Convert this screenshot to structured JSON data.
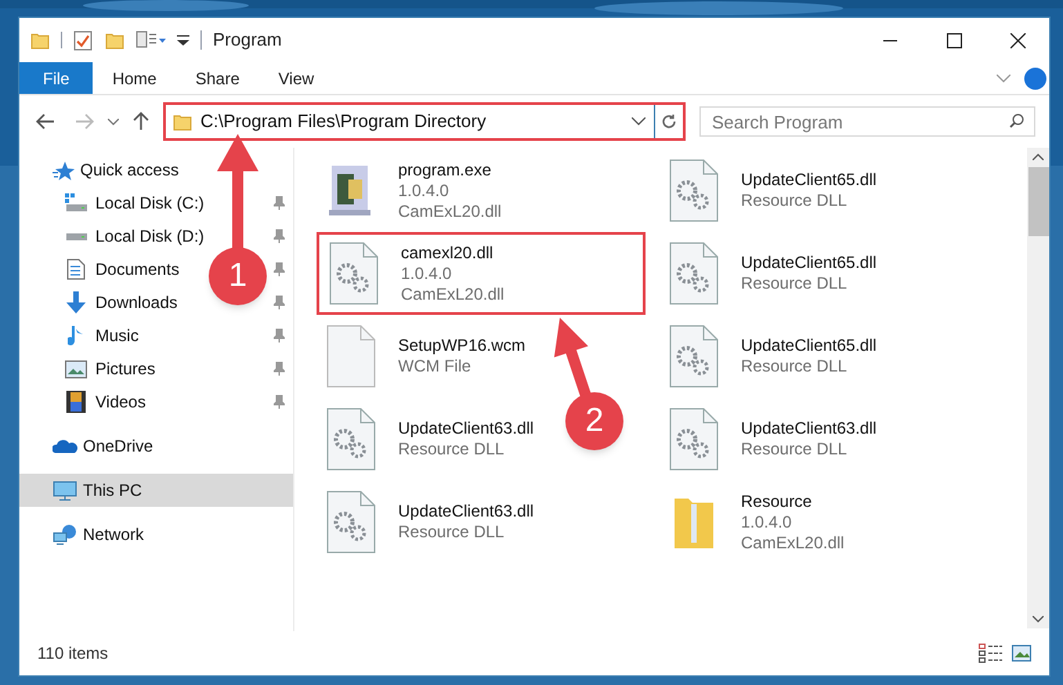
{
  "window": {
    "title": "Program"
  },
  "ribbon_tabs": [
    {
      "label": "File",
      "selected": true
    },
    {
      "label": "Home",
      "selected": false
    },
    {
      "label": "Share",
      "selected": false
    },
    {
      "label": "View",
      "selected": false
    }
  ],
  "address_bar": {
    "path": "C:\\Program Files\\Program Directory",
    "highlighted": true
  },
  "search": {
    "placeholder": "Search Program"
  },
  "navigation": [
    {
      "label": "Quick access",
      "selected": false,
      "children": [
        {
          "label": "Local Disk (C:)",
          "pinned": true,
          "selected": false
        },
        {
          "label": "Local Disk (D:)",
          "pinned": true,
          "selected": false
        },
        {
          "label": "Documents",
          "pinned": true,
          "selected": false
        },
        {
          "label": "Downloads",
          "pinned": true,
          "selected": false
        },
        {
          "label": "Music",
          "pinned": true,
          "selected": false
        },
        {
          "label": "Pictures",
          "pinned": true,
          "selected": false
        },
        {
          "label": "Videos",
          "pinned": true,
          "selected": false
        }
      ]
    },
    {
      "label": "OneDrive",
      "selected": false
    },
    {
      "label": "This PC",
      "selected": true
    },
    {
      "label": "Network",
      "selected": false
    }
  ],
  "files": [
    {
      "kind": "exe",
      "lines": [
        "program.exe",
        "1.0.4.0",
        "CamExL20.dll"
      ],
      "highlighted": false
    },
    {
      "kind": "dll",
      "lines": [
        "UpdateClient65.dll",
        "Resource DLL"
      ],
      "highlighted": false
    },
    {
      "kind": "dll",
      "lines": [
        "camexl20.dll",
        "1.0.4.0",
        "CamExL20.dll"
      ],
      "highlighted": true
    },
    {
      "kind": "dll",
      "lines": [
        "UpdateClient65.dll",
        "Resource DLL"
      ],
      "highlighted": false
    },
    {
      "kind": "file",
      "lines": [
        "SetupWP16.wcm",
        "WCM File"
      ],
      "highlighted": false
    },
    {
      "kind": "dll",
      "lines": [
        "UpdateClient65.dll",
        "Resource DLL"
      ],
      "highlighted": false
    },
    {
      "kind": "dll",
      "lines": [
        "UpdateClient63.dll",
        "Resource DLL"
      ],
      "highlighted": false
    },
    {
      "kind": "dll",
      "lines": [
        "UpdateClient63.dll",
        "Resource DLL"
      ],
      "highlighted": false
    },
    {
      "kind": "dll",
      "lines": [
        "UpdateClient63.dll",
        "Resource DLL"
      ],
      "highlighted": false
    },
    {
      "kind": "folder",
      "lines": [
        "Resource",
        "1.0.4.0",
        "CamExL20.dll"
      ],
      "highlighted": false
    }
  ],
  "status_bar": {
    "item_count": "110 items"
  },
  "callouts": [
    {
      "label": "1"
    },
    {
      "label": "2"
    }
  ]
}
